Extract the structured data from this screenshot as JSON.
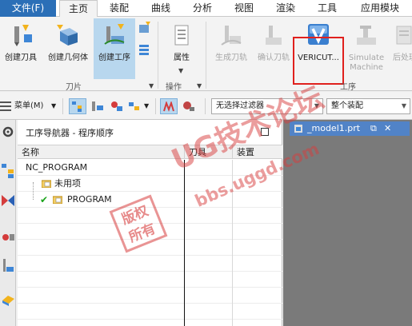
{
  "menu": {
    "file": "文件(F)",
    "tabs": [
      "主页",
      "装配",
      "曲线",
      "分析",
      "视图",
      "渲染",
      "工具",
      "应用模块"
    ]
  },
  "ribbon": {
    "buttons": [
      {
        "label": "创建刀具",
        "icon": "create-tool-icon",
        "state": "normal"
      },
      {
        "label": "创建几何体",
        "icon": "create-geometry-icon",
        "state": "normal"
      },
      {
        "label": "创建工序",
        "icon": "create-operation-icon",
        "state": "selected"
      },
      {
        "label": "属性",
        "icon": "properties-icon",
        "state": "normal"
      },
      {
        "label": "生成刀轨",
        "icon": "generate-toolpath-icon",
        "state": "disabled"
      },
      {
        "label": "确认刀轨",
        "icon": "verify-toolpath-icon",
        "state": "disabled"
      },
      {
        "label": "VERICUT...",
        "icon": "vericut-icon",
        "state": "highlighted"
      },
      {
        "label": "Simulate Machine",
        "icon": "simulate-machine-icon",
        "state": "disabled"
      },
      {
        "label": "后处理",
        "icon": "postprocess-icon",
        "state": "disabled"
      }
    ],
    "groups": {
      "insert": "刀片",
      "operate": "操作",
      "operation": "工序"
    }
  },
  "toolbar2": {
    "menu_label": "菜单(M)",
    "filter_combo": "无选择过滤器",
    "scope_combo": "整个装配"
  },
  "navigator": {
    "title": "工序导航器 - 程序顺序",
    "columns": [
      "名称",
      "刀具",
      "装置"
    ],
    "rows": [
      {
        "name": "NC_PROGRAM",
        "level": 0
      },
      {
        "name": "未用项",
        "level": 1
      },
      {
        "name": "PROGRAM",
        "level": 1
      }
    ]
  },
  "graphics": {
    "tab_title": "_model1.prt"
  },
  "watermark": {
    "site": "UG技术论坛",
    "url": "bbs.uggd.com",
    "seal": "版权所有"
  },
  "colors": {
    "file_tab": "#2b6fb7",
    "selected": "#b8d7ee",
    "highlight_box": "#e0201d",
    "graphics_bg": "#7a7a7a",
    "graphics_tab": "#5183c7"
  }
}
